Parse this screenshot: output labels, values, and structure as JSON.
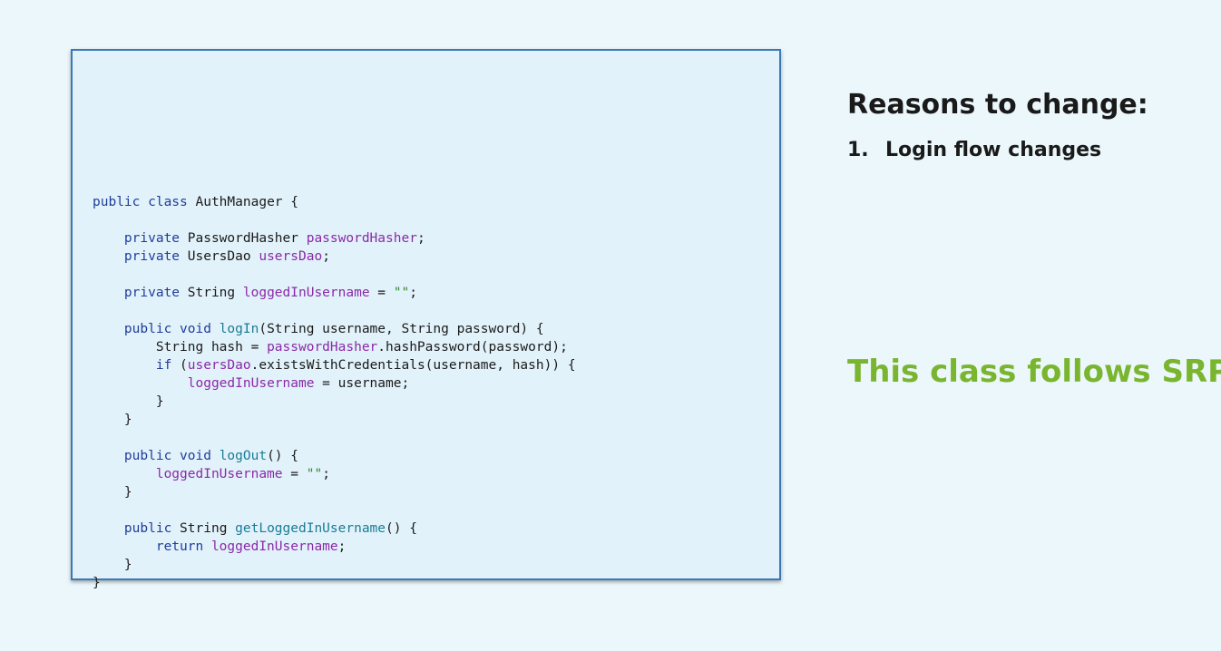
{
  "code_panel": {
    "lines": [
      [],
      [],
      [],
      [],
      [
        {
          "t": "public class",
          "c": "kw"
        },
        {
          "t": " AuthManager {",
          "c": "plain"
        }
      ],
      [],
      [
        {
          "t": "    private",
          "c": "kw"
        },
        {
          "t": " PasswordHasher ",
          "c": "plain"
        },
        {
          "t": "passwordHasher",
          "c": "field"
        },
        {
          "t": ";",
          "c": "plain"
        }
      ],
      [
        {
          "t": "    private",
          "c": "kw"
        },
        {
          "t": " UsersDao ",
          "c": "plain"
        },
        {
          "t": "usersDao",
          "c": "field"
        },
        {
          "t": ";",
          "c": "plain"
        }
      ],
      [],
      [
        {
          "t": "    private",
          "c": "kw"
        },
        {
          "t": " String ",
          "c": "plain"
        },
        {
          "t": "loggedInUsername",
          "c": "field"
        },
        {
          "t": " = ",
          "c": "plain"
        },
        {
          "t": "\"\"",
          "c": "str"
        },
        {
          "t": ";",
          "c": "plain"
        }
      ],
      [],
      [
        {
          "t": "    public void",
          "c": "kw"
        },
        {
          "t": " ",
          "c": "plain"
        },
        {
          "t": "logIn",
          "c": "method"
        },
        {
          "t": "(String username, String password) {",
          "c": "plain"
        }
      ],
      [
        {
          "t": "        String hash = ",
          "c": "plain"
        },
        {
          "t": "passwordHasher",
          "c": "field"
        },
        {
          "t": ".hashPassword(password);",
          "c": "plain"
        }
      ],
      [
        {
          "t": "        if",
          "c": "kw"
        },
        {
          "t": " (",
          "c": "plain"
        },
        {
          "t": "usersDao",
          "c": "field"
        },
        {
          "t": ".existsWithCredentials(username, hash)) {",
          "c": "plain"
        }
      ],
      [
        {
          "t": "            ",
          "c": "plain"
        },
        {
          "t": "loggedInUsername",
          "c": "field"
        },
        {
          "t": " = username;",
          "c": "plain"
        }
      ],
      [
        {
          "t": "        }",
          "c": "plain"
        }
      ],
      [
        {
          "t": "    }",
          "c": "plain"
        }
      ],
      [],
      [
        {
          "t": "    public void",
          "c": "kw"
        },
        {
          "t": " ",
          "c": "plain"
        },
        {
          "t": "logOut",
          "c": "method"
        },
        {
          "t": "() {",
          "c": "plain"
        }
      ],
      [
        {
          "t": "        ",
          "c": "plain"
        },
        {
          "t": "loggedInUsername",
          "c": "field"
        },
        {
          "t": " = ",
          "c": "plain"
        },
        {
          "t": "\"\"",
          "c": "str"
        },
        {
          "t": ";",
          "c": "plain"
        }
      ],
      [
        {
          "t": "    }",
          "c": "plain"
        }
      ],
      [],
      [
        {
          "t": "    public",
          "c": "kw"
        },
        {
          "t": " String ",
          "c": "plain"
        },
        {
          "t": "getLoggedInUsername",
          "c": "method"
        },
        {
          "t": "() {",
          "c": "plain"
        }
      ],
      [
        {
          "t": "        return",
          "c": "kw"
        },
        {
          "t": " ",
          "c": "plain"
        },
        {
          "t": "loggedInUsername",
          "c": "field"
        },
        {
          "t": ";",
          "c": "plain"
        }
      ],
      [
        {
          "t": "    }",
          "c": "plain"
        }
      ],
      [
        {
          "t": "}",
          "c": "plain"
        }
      ]
    ]
  },
  "side": {
    "heading": "Reasons to change:",
    "reasons": [
      {
        "num": "1.",
        "text": "Login flow changes"
      }
    ],
    "verdict": "This class follows SRP!"
  },
  "colors": {
    "background": "#ebf7fb",
    "panel": "#e2f2fa",
    "panel_border": "#3a78b8",
    "keyword": "#1f3d9b",
    "field": "#8a2aa8",
    "method": "#1a7c96",
    "string": "#2e8a2e",
    "verdict": "#7ab530"
  }
}
